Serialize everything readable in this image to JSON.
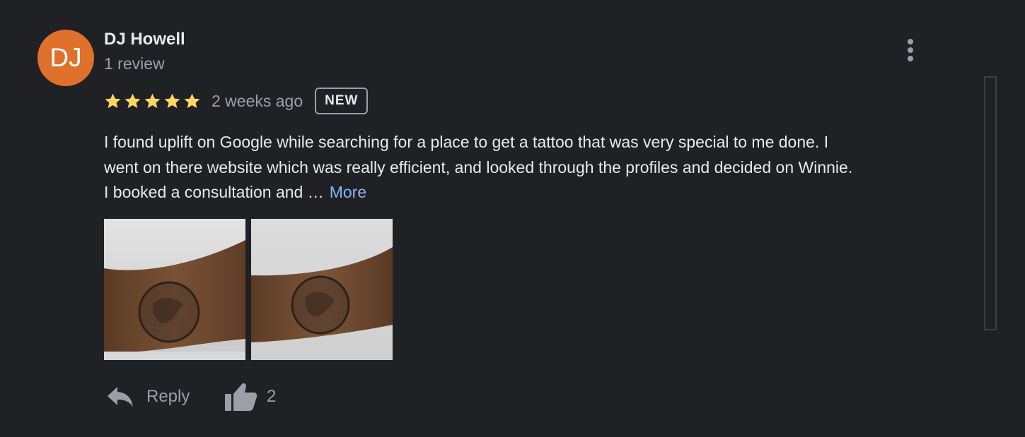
{
  "reviewer": {
    "initials": "DJ",
    "name": "DJ Howell",
    "review_count": "1 review",
    "avatar_color": "#e0712c"
  },
  "review": {
    "rating": 5,
    "rating_max": 5,
    "star_icon": "star-icon",
    "star_color": "#fdd663",
    "time_ago": "2 weeks ago",
    "badge": "NEW",
    "text_lines": [
      "I found uplift on Google while searching for a place to get a tattoo that was very special to me done. I",
      "went on there website which was really efficient, and looked through the profiles and decided on Winnie.",
      "I booked a consultation and …"
    ],
    "more_label": "More",
    "photo_count": 2
  },
  "menu": {
    "icon": "more-vert-icon"
  },
  "actions": {
    "reply_label": "Reply",
    "reply_icon": "reply-icon",
    "like_icon": "thumbs-up-icon",
    "like_count": "2"
  },
  "colors": {
    "background": "#202124",
    "primary_text": "#e8eaed",
    "secondary_text": "#9aa0a6",
    "link": "#8ab4f8"
  }
}
